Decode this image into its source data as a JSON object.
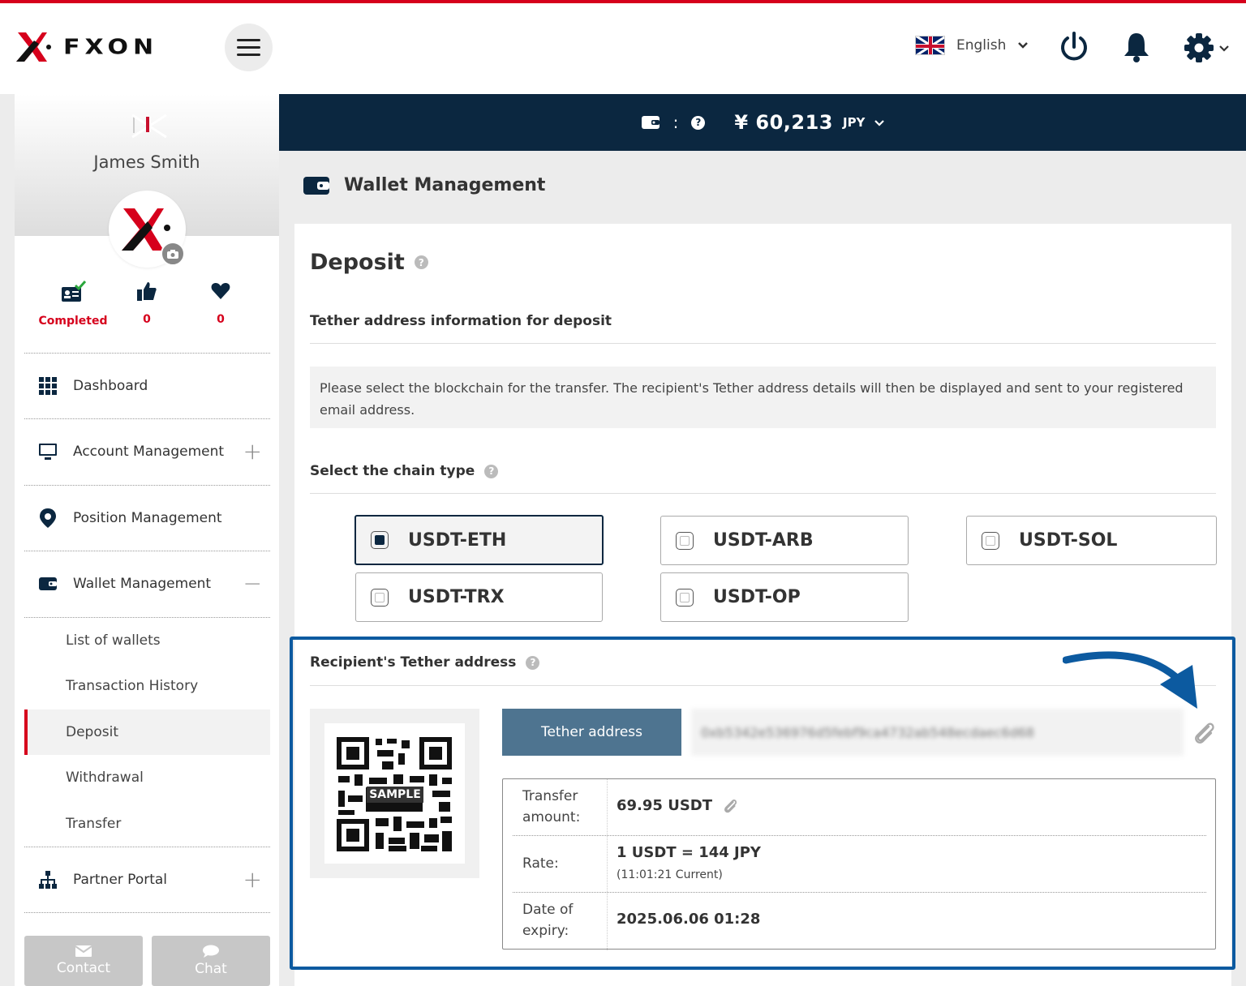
{
  "header": {
    "logo_text": "FXON",
    "language": "English"
  },
  "balance": {
    "separator": ":",
    "amount": "¥ 60,213",
    "currency": "JPY"
  },
  "profile": {
    "name": "James Smith",
    "stats": [
      {
        "icon": "id-card-check-icon",
        "label": "Completed"
      },
      {
        "icon": "thumbs-up-icon",
        "label": "0"
      },
      {
        "icon": "heart-icon",
        "label": "0"
      }
    ]
  },
  "sidebar": {
    "items": [
      {
        "label": "Dashboard",
        "icon": "grid-icon"
      },
      {
        "label": "Account Management",
        "icon": "monitor-icon",
        "toggle": "+"
      },
      {
        "label": "Position Management",
        "icon": "map-pin-icon"
      },
      {
        "label": "Wallet Management",
        "icon": "wallet-icon",
        "toggle": "−"
      }
    ],
    "wallet_sub": [
      {
        "label": "List of wallets"
      },
      {
        "label": "Transaction History"
      },
      {
        "label": "Deposit",
        "active": true
      },
      {
        "label": "Withdrawal"
      },
      {
        "label": "Transfer"
      }
    ],
    "partner": {
      "label": "Partner Portal",
      "toggle": "+"
    },
    "buttons": {
      "contact": "Contact",
      "chat": "Chat"
    }
  },
  "page": {
    "title": "Wallet Management",
    "heading": "Deposit",
    "section1": "Tether address information for deposit",
    "note": "Please select the blockchain for the transfer. The recipient's Tether address details will then be displayed and sent to your registered email address.",
    "section2": "Select the chain type",
    "chains": [
      {
        "label": "USDT-ETH",
        "selected": true
      },
      {
        "label": "USDT-ARB",
        "selected": false
      },
      {
        "label": "USDT-SOL",
        "selected": false
      },
      {
        "label": "USDT-TRX",
        "selected": false
      },
      {
        "label": "USDT-OP",
        "selected": false
      }
    ],
    "section3": "Recipient's Tether address",
    "qr_label": "SAMPLE",
    "address_button": "Tether address",
    "address_value": "0xb5342e536976d5febf9ca4732ab548ecdaec6d68",
    "details": {
      "amount_label": "Transfer amount:",
      "amount_value": "69.95 USDT",
      "rate_label": "Rate:",
      "rate_value": "1 USDT = 144 JPY",
      "rate_time": "(11:01:21 Current)",
      "expiry_label": "Date of expiry:",
      "expiry_value": "2025.06.06 01:28"
    }
  },
  "colors": {
    "brand_red": "#d6001c",
    "navy": "#0b2740",
    "highlight_blue": "#0c5aa0",
    "button_steel": "#4e7490"
  }
}
